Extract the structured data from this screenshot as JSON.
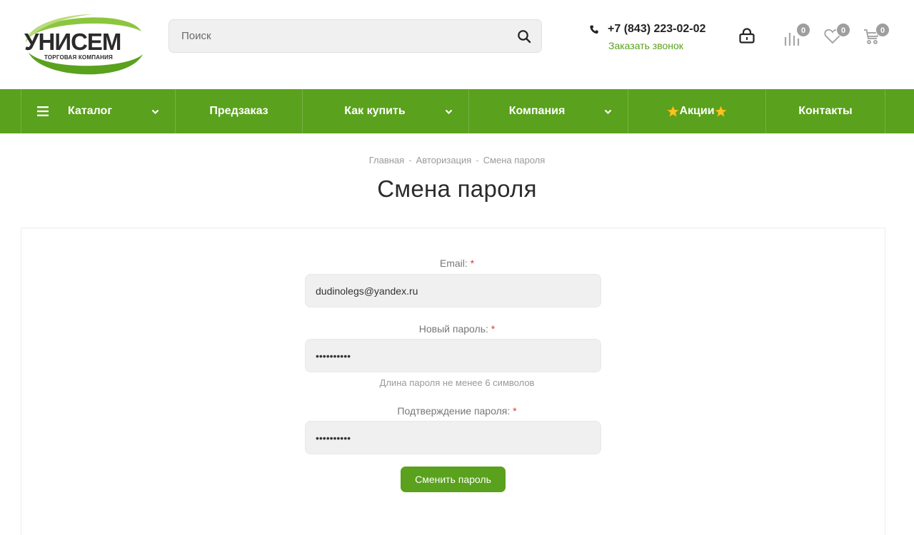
{
  "header": {
    "logo": {
      "main": "УНИСЕМ",
      "sub": "ТОРГОВАЯ КОМПАНИЯ"
    },
    "search": {
      "placeholder": "Поиск"
    },
    "phone": "+7 (843) 223-02-02",
    "callback_label": "Заказать звонок",
    "counters": {
      "compare": "0",
      "favorites": "0",
      "cart": "0"
    }
  },
  "nav": {
    "items": [
      {
        "label": "Каталог"
      },
      {
        "label": "Предзаказ"
      },
      {
        "label": "Как купить"
      },
      {
        "label": "Компания"
      },
      {
        "label": "Акции"
      },
      {
        "label": "Контакты"
      }
    ]
  },
  "breadcrumb": [
    "Главная",
    "Авторизация",
    "Смена пароля"
  ],
  "page_title": "Смена пароля",
  "form": {
    "email": {
      "label": "Email:",
      "value": "dudinolegs@yandex.ru"
    },
    "new_password": {
      "label": "Новый пароль:",
      "value": "••••••••••",
      "hint": "Длина пароля не менее 6 символов"
    },
    "confirm_password": {
      "label": "Подтверждение пароля:",
      "value": "••••••••••"
    },
    "required_mark": "*",
    "submit_label": "Сменить пароль"
  },
  "colors": {
    "brand_green": "#5aa11d",
    "required_red": "#e0383e",
    "badge_gray": "#9e9e9e"
  }
}
